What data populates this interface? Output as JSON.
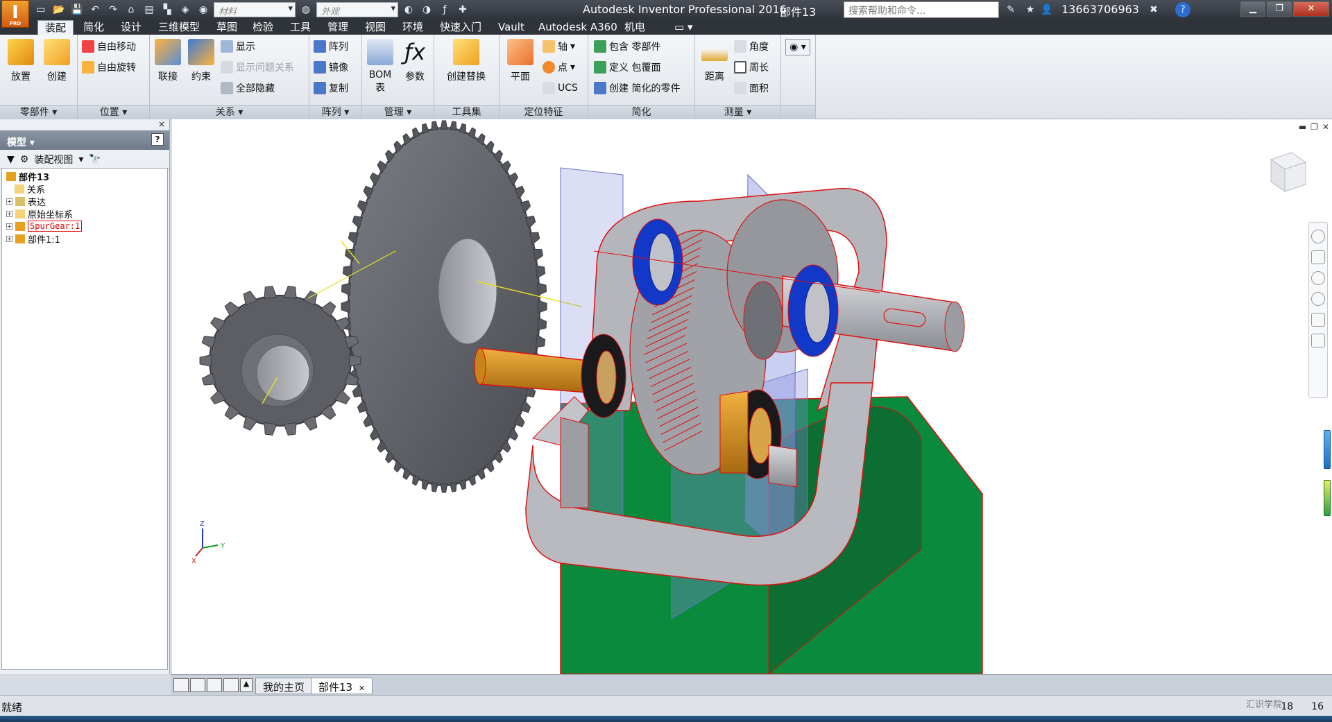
{
  "app": {
    "title": "Autodesk Inventor Professional 2016",
    "document": "部件13",
    "logo_letter": "I",
    "logo_sub": "PRO",
    "material_placeholder": "材料",
    "appearance_placeholder": "外观",
    "search_placeholder": "搜索帮助和命令...",
    "user": "13663706963",
    "help": "?"
  },
  "tabs": [
    "装配",
    "简化",
    "设计",
    "三维模型",
    "草图",
    "检验",
    "工具",
    "管理",
    "视图",
    "环境",
    "快速入门",
    "Vault",
    "Autodesk A360",
    "机电"
  ],
  "ribbon": {
    "groups": {
      "components": "零部件",
      "position": "位置",
      "relationships": "关系",
      "pattern": "阵列",
      "manage": "管理",
      "toolbox": "工具集",
      "work_features": "定位特征",
      "simplify": "简化",
      "measure": "测量"
    },
    "buttons": {
      "place": "放置",
      "create": "创建",
      "free_move": "自由移动",
      "free_rotate": "自由旋转",
      "joint": "联接",
      "constrain": "约束",
      "show": "显示",
      "show_sick": "显示问题关系",
      "hide_all": "全部隐藏",
      "pattern": "阵列",
      "mirror": "镜像",
      "copy": "复制",
      "bom": "BOM",
      "bom_2": "表",
      "params": "参数",
      "create_substitute": "创建替换",
      "plane": "平面",
      "axis": "轴",
      "point": "点",
      "ucs": "UCS",
      "include_components": "包含 零部件",
      "define_envelope": "定义 包覆面",
      "create_simplified": "创建 简化的零件",
      "distance": "距离",
      "angle": "角度",
      "perimeter": "周长",
      "area": "面积"
    }
  },
  "browser": {
    "title": "模型",
    "view_label": "装配视图",
    "tree": [
      {
        "label": "部件13",
        "bold": true,
        "expander": ""
      },
      {
        "label": "关系",
        "bold": false,
        "expander": ""
      },
      {
        "label": "表达",
        "bold": false,
        "expander": "+"
      },
      {
        "label": "原始坐标系",
        "bold": false,
        "expander": "+"
      },
      {
        "label": "SpurGear:1",
        "bold": false,
        "expander": "+",
        "error": true
      },
      {
        "label": "部件1:1",
        "bold": false,
        "expander": "+"
      }
    ]
  },
  "viewport": {
    "axis_x": "X",
    "axis_y": "Y",
    "axis_z": "Z"
  },
  "doc_tabs": [
    "我的主页",
    "部件13"
  ],
  "status": {
    "text": "就绪",
    "num1": "18",
    "num2": "16",
    "watermark": "汇识学院"
  },
  "colors": {
    "housing_green": "#0a8a3c",
    "gear_gray": "#5f6168",
    "bearing_blue": "#1238c8",
    "shaft_orange": "#d8961a",
    "edge_red": "#e01010"
  }
}
